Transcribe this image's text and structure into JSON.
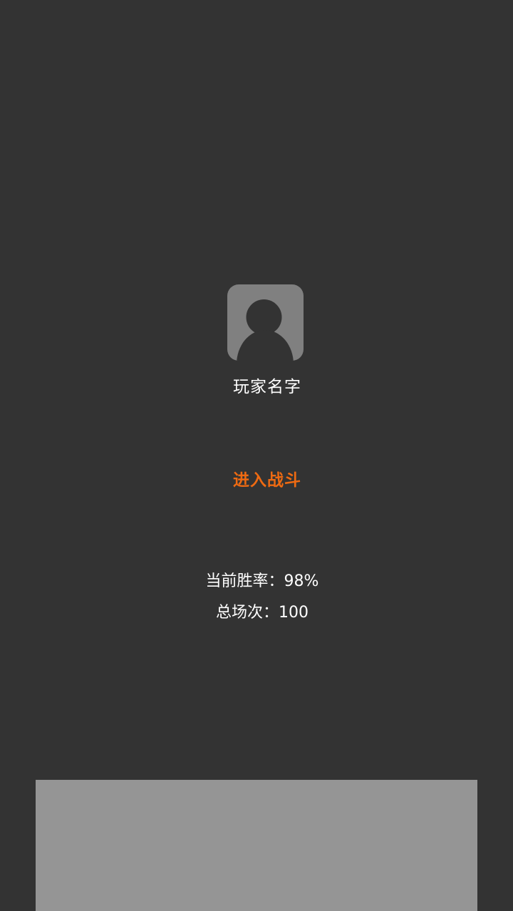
{
  "profile": {
    "avatar_icon": "default-user-icon",
    "name": "玩家名字"
  },
  "actions": {
    "enter_battle_label": "进入战斗",
    "enter_battle_color": "#ee6a12"
  },
  "stats": {
    "win_rate_label": "当前胜率：",
    "win_rate_value": "98%",
    "total_matches_label": "总场次：",
    "total_matches_value": "100"
  },
  "colors": {
    "background": "#333333",
    "avatar_bg": "#808080",
    "bottom_panel": "#959595"
  }
}
